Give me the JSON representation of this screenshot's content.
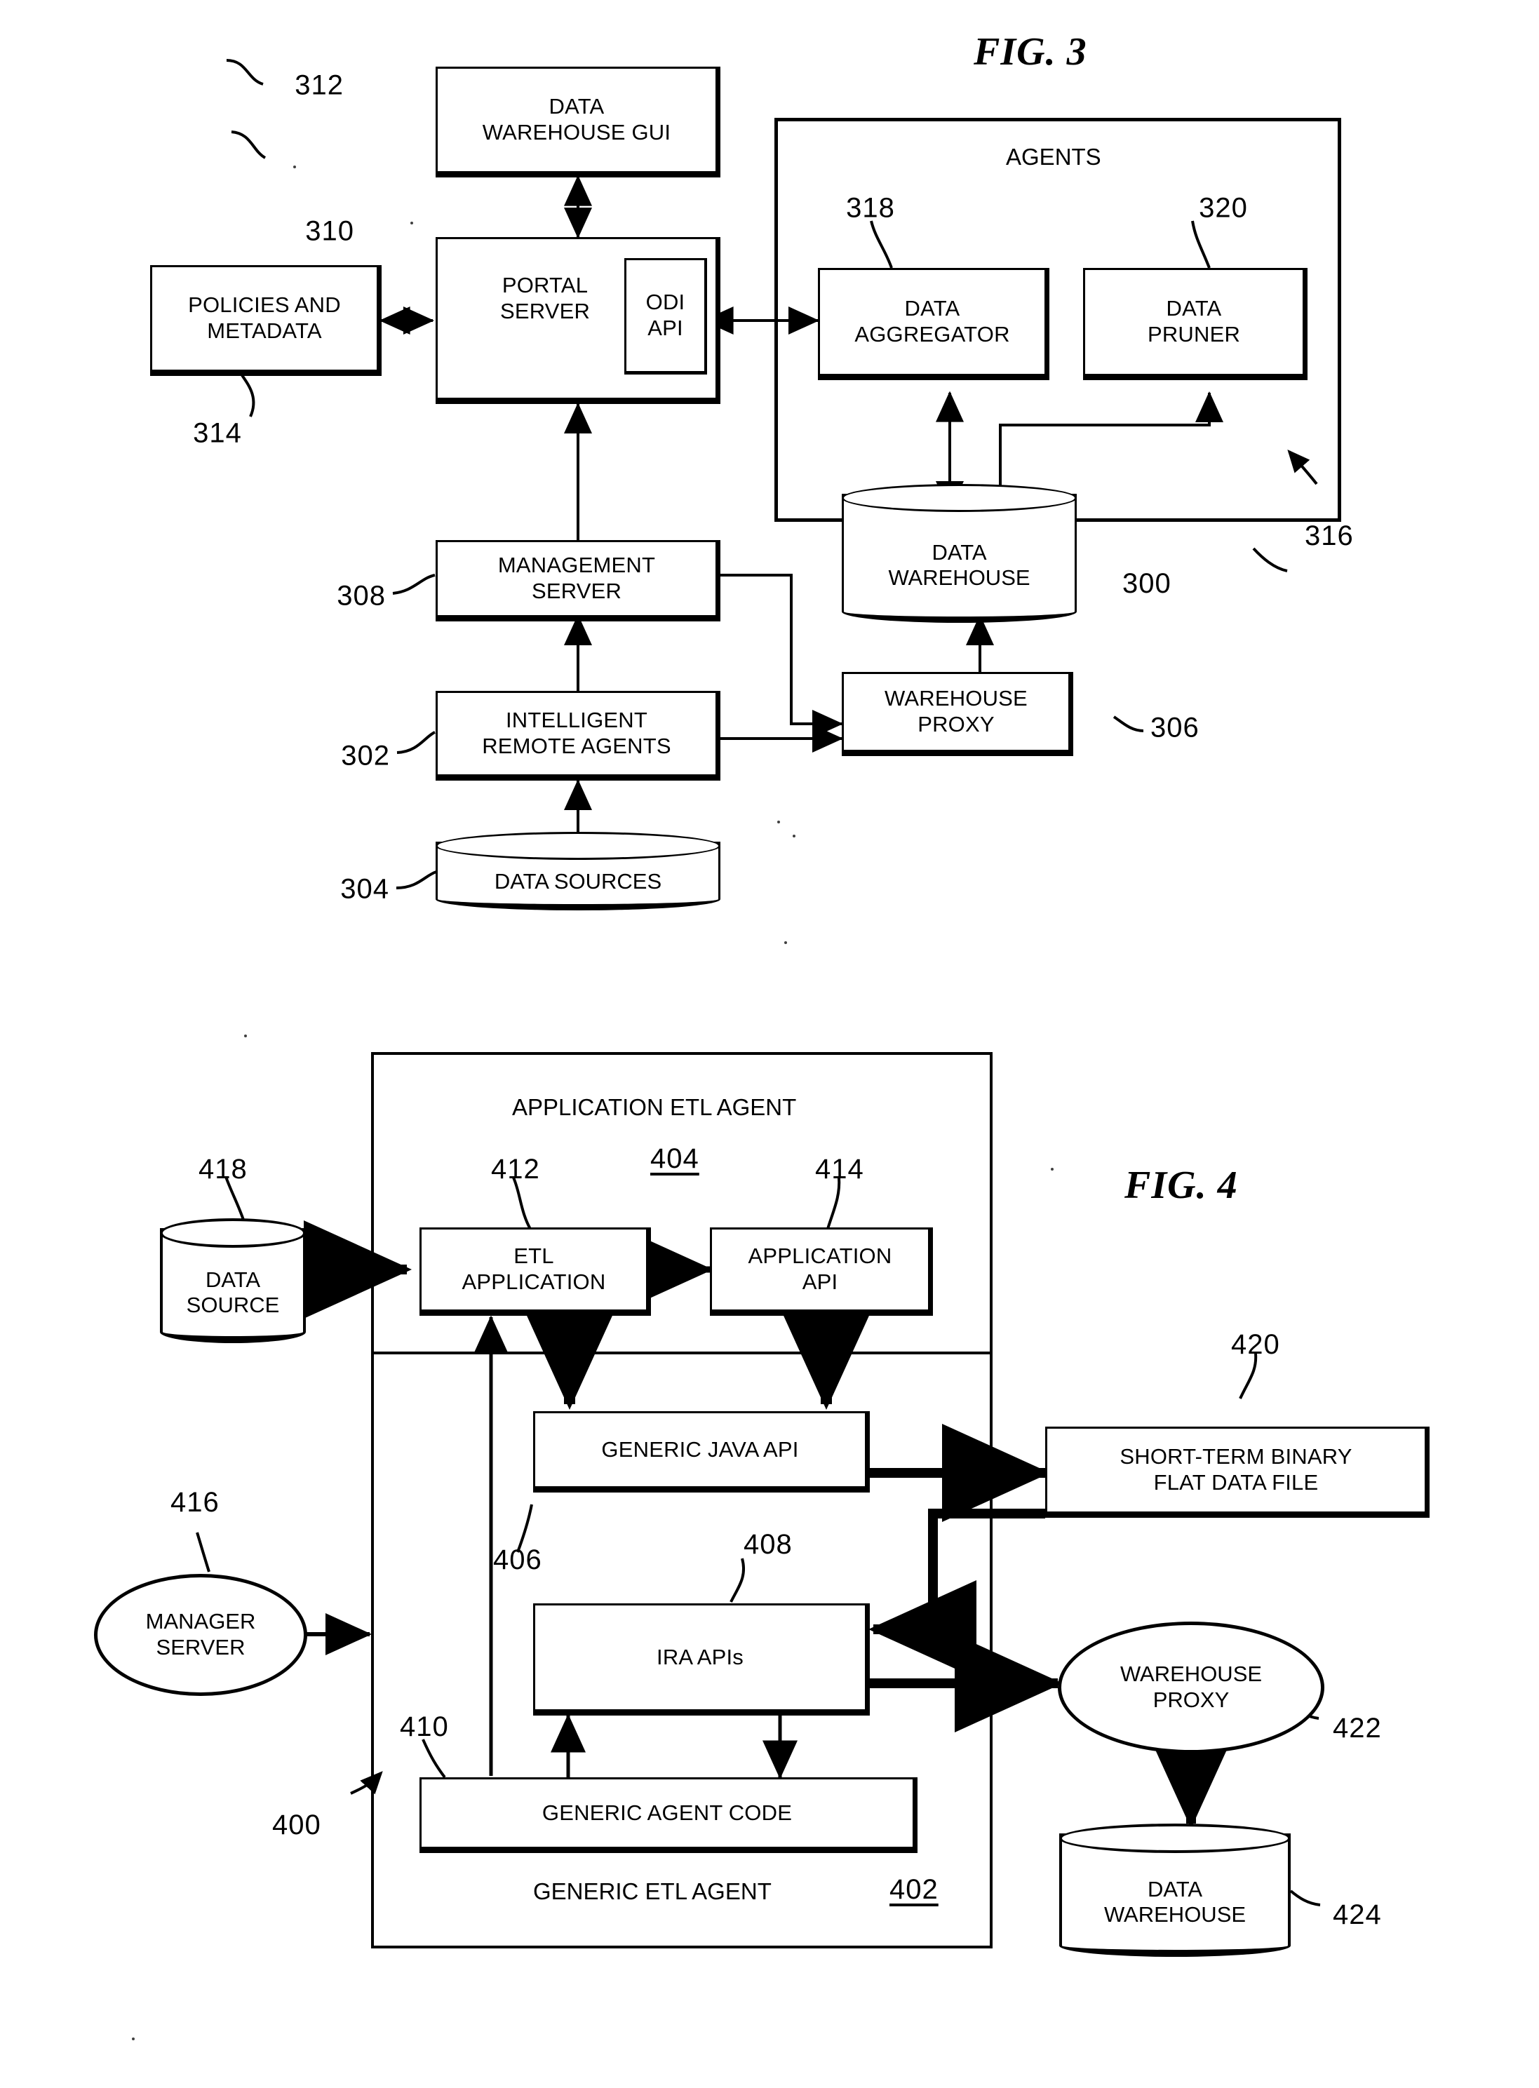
{
  "figures": [
    {
      "id": "fig3",
      "title": "FIG. 3",
      "group_label": "AGENTS",
      "nodes": [
        {
          "ref": "312",
          "label": "DATA\nWAREHOUSE GUI",
          "shape": "rect"
        },
        {
          "ref": "310",
          "label": "PORTAL\nSERVER",
          "shape": "rect"
        },
        {
          "ref": "",
          "label": "ODI\nAPI",
          "shape": "rect"
        },
        {
          "ref": "314",
          "label": "POLICIES AND\nMETADATA",
          "shape": "rect"
        },
        {
          "ref": "318",
          "label": "DATA\nAGGREGATOR",
          "shape": "rect"
        },
        {
          "ref": "320",
          "label": "DATA\nPRUNER",
          "shape": "rect"
        },
        {
          "ref": "316",
          "label": "AGENTS",
          "shape": "container"
        },
        {
          "ref": "300",
          "label": "DATA\nWAREHOUSE",
          "shape": "cylinder"
        },
        {
          "ref": "308",
          "label": "MANAGEMENT\nSERVER",
          "shape": "rect"
        },
        {
          "ref": "306",
          "label": "WAREHOUSE\nPROXY",
          "shape": "rect"
        },
        {
          "ref": "302",
          "label": "INTELLIGENT\nREMOTE AGENTS",
          "shape": "rect"
        },
        {
          "ref": "304",
          "label": "DATA SOURCES",
          "shape": "cylinder"
        }
      ],
      "labels": {
        "data_warehouse_gui_line1": "DATA",
        "data_warehouse_gui_line2": "WAREHOUSE GUI",
        "portal_server_line1": "PORTAL",
        "portal_server_line2": "SERVER",
        "odi_api_line1": "ODI",
        "odi_api_line2": "API",
        "policies_line1": "POLICIES AND",
        "policies_line2": "METADATA",
        "agents": "AGENTS",
        "data_aggregator_line1": "DATA",
        "data_aggregator_line2": "AGGREGATOR",
        "data_pruner_line1": "DATA",
        "data_pruner_line2": "PRUNER",
        "data_warehouse_line1": "DATA",
        "data_warehouse_line2": "WAREHOUSE",
        "management_server_line1": "MANAGEMENT",
        "management_server_line2": "SERVER",
        "warehouse_proxy_line1": "WAREHOUSE",
        "warehouse_proxy_line2": "PROXY",
        "intelligent_remote_agents_line1": "INTELLIGENT",
        "intelligent_remote_agents_line2": "REMOTE AGENTS",
        "data_sources": "DATA SOURCES"
      },
      "refs": {
        "r312": "312",
        "r310": "310",
        "r314": "314",
        "r318": "318",
        "r320": "320",
        "r316": "316",
        "r300": "300",
        "r308": "308",
        "r306": "306",
        "r302": "302",
        "r304": "304"
      }
    },
    {
      "id": "fig4",
      "title": "FIG. 4",
      "group_label_top": "APPLICATION ETL AGENT",
      "group_label_bottom": "GENERIC ETL AGENT",
      "labels": {
        "application_etl_agent": "APPLICATION ETL AGENT",
        "generic_etl_agent": "GENERIC ETL AGENT",
        "data_source_line1": "DATA",
        "data_source_line2": "SOURCE",
        "etl_application_line1": "ETL",
        "etl_application_line2": "APPLICATION",
        "application_api_line1": "APPLICATION",
        "application_api_line2": "API",
        "generic_java_api": "GENERIC JAVA API",
        "short_term_file_line1": "SHORT-TERM BINARY",
        "short_term_file_line2": "FLAT DATA FILE",
        "manager_server_line1": "MANAGER",
        "manager_server_line2": "SERVER",
        "ira_apis": "IRA APIs",
        "warehouse_proxy_line1": "WAREHOUSE",
        "warehouse_proxy_line2": "PROXY",
        "generic_agent_code": "GENERIC AGENT CODE",
        "data_warehouse_line1": "DATA",
        "data_warehouse_line2": "WAREHOUSE"
      },
      "refs": {
        "r400": "400",
        "r402": "402",
        "r404": "404",
        "r406": "406",
        "r408": "408",
        "r410": "410",
        "r412": "412",
        "r414": "414",
        "r416": "416",
        "r418": "418",
        "r420": "420",
        "r422": "422",
        "r424": "424"
      }
    }
  ],
  "colors": {
    "ink": "#000000",
    "paper": "#ffffff"
  }
}
